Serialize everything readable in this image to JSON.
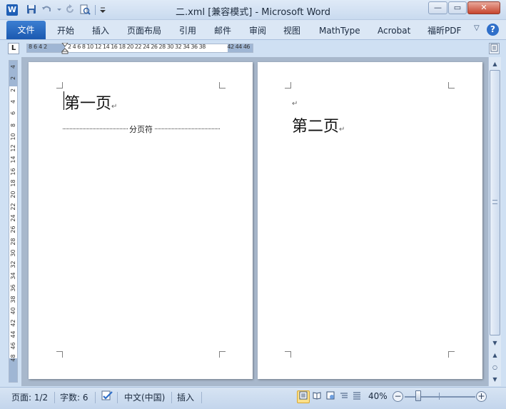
{
  "window": {
    "title": "二.xml [兼容模式] - Microsoft Word",
    "logo_letter": "W",
    "minimize": "—",
    "restore": "▭",
    "close": "✕"
  },
  "quick_access": {
    "save_icon": "save-icon",
    "undo_icon": "undo-icon",
    "redo_icon": "redo-icon",
    "print_preview_icon": "print-preview-icon",
    "customize_icon": "customize-dropdown-icon"
  },
  "ribbon": {
    "tabs": [
      "文件",
      "开始",
      "插入",
      "页面布局",
      "引用",
      "邮件",
      "审阅",
      "视图",
      "MathType",
      "Acrobat",
      "福昕PDF"
    ],
    "help": "?",
    "minimize_ribbon": "▽"
  },
  "ruler": {
    "tab_selector": "L",
    "left_numbers": "8 6 4 2",
    "middle_numbers": "2  4  6  8 10 12 14 16 18 20 22 24 26 28 30 32 34 36 38",
    "right_numbers": "42 44 46",
    "vertical_numbers": [
      "4",
      "2",
      "2",
      "4",
      "6",
      "8",
      "10",
      "12",
      "14",
      "16",
      "18",
      "20",
      "22",
      "24",
      "26",
      "28",
      "30",
      "32",
      "34",
      "36",
      "38",
      "40",
      "42",
      "44",
      "46",
      "48"
    ]
  },
  "document": {
    "page1_text": "第一页",
    "page_break_label": "分页符",
    "page2_text": "第二页",
    "para_mark": "↵"
  },
  "status": {
    "page": "页面: 1/2",
    "words": "字数: 6",
    "language": "中文(中国)",
    "mode": "插入",
    "zoom": "40%",
    "zoom_minus": "−",
    "zoom_plus": "+"
  }
}
